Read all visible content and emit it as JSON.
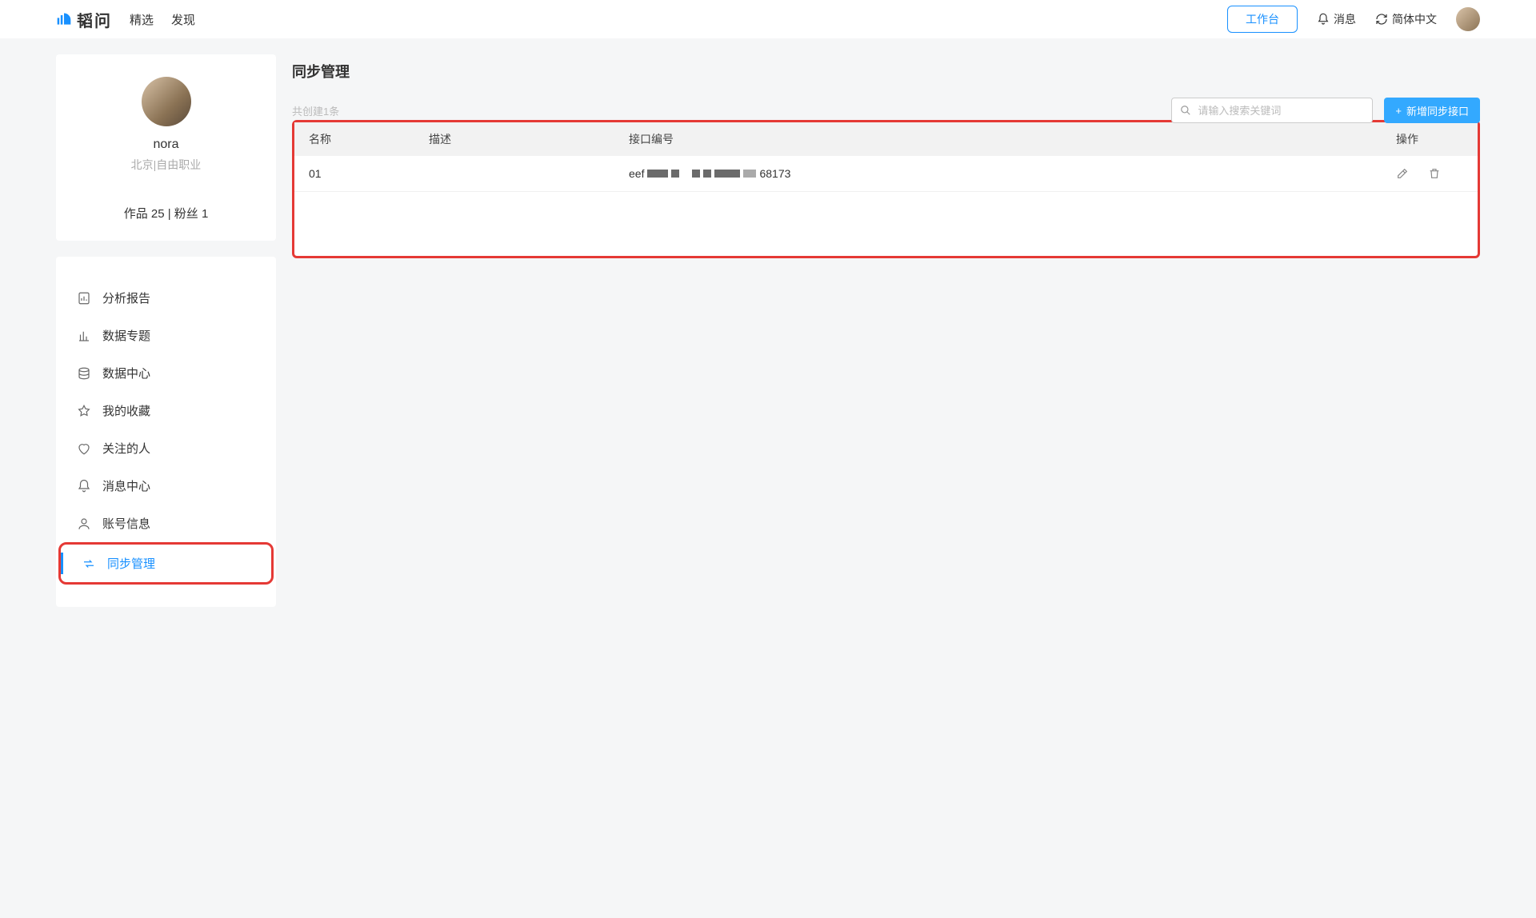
{
  "header": {
    "logo_text": "韬问",
    "nav": {
      "featured": "精选",
      "discover": "发现"
    },
    "workspace": "工作台",
    "messages": "消息",
    "language": "简体中文"
  },
  "profile": {
    "username": "nora",
    "location": "北京|自由职业",
    "stats": "作品 25 | 粉丝 1"
  },
  "sidebar": {
    "items": [
      {
        "label": "分析报告"
      },
      {
        "label": "数据专题"
      },
      {
        "label": "数据中心"
      },
      {
        "label": "我的收藏"
      },
      {
        "label": "关注的人"
      },
      {
        "label": "消息中心"
      },
      {
        "label": "账号信息"
      },
      {
        "label": "同步管理"
      }
    ]
  },
  "main": {
    "title": "同步管理",
    "count_text": "共创建1条",
    "search_placeholder": "请输入搜索关键词",
    "add_button": "新增同步接口",
    "columns": {
      "name": "名称",
      "desc": "描述",
      "id": "接口编号",
      "actions": "操作"
    },
    "rows": [
      {
        "name": "01",
        "desc": "",
        "id_prefix": "eef",
        "id_suffix": "68173"
      }
    ]
  }
}
